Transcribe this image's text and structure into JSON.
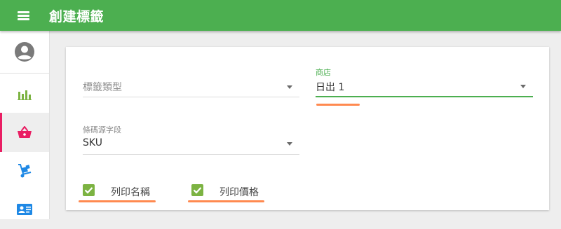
{
  "theme": {
    "brand": "#4caf50",
    "accent": "#4caf50",
    "highlight": "#ff8a50",
    "active_indicator": "#e91e63"
  },
  "header": {
    "title": "創建標籤",
    "menu_icon": "hamburger-menu-icon"
  },
  "sidebar": {
    "items": [
      {
        "icon": "account-circle-icon"
      },
      {
        "icon": "bar-chart-icon"
      },
      {
        "icon": "shopping-basket-icon",
        "active": true
      },
      {
        "icon": "hand-truck-icon"
      },
      {
        "icon": "contact-card-icon"
      }
    ]
  },
  "form": {
    "label_type": {
      "placeholder": "標籤類型"
    },
    "store": {
      "label": "商店",
      "value": "日出 1"
    },
    "barcode_source": {
      "label": "條碼源字段",
      "value": "SKU"
    },
    "print_name": {
      "label": "列印名稱",
      "checked": true
    },
    "print_price": {
      "label": "列印價格",
      "checked": true
    }
  }
}
